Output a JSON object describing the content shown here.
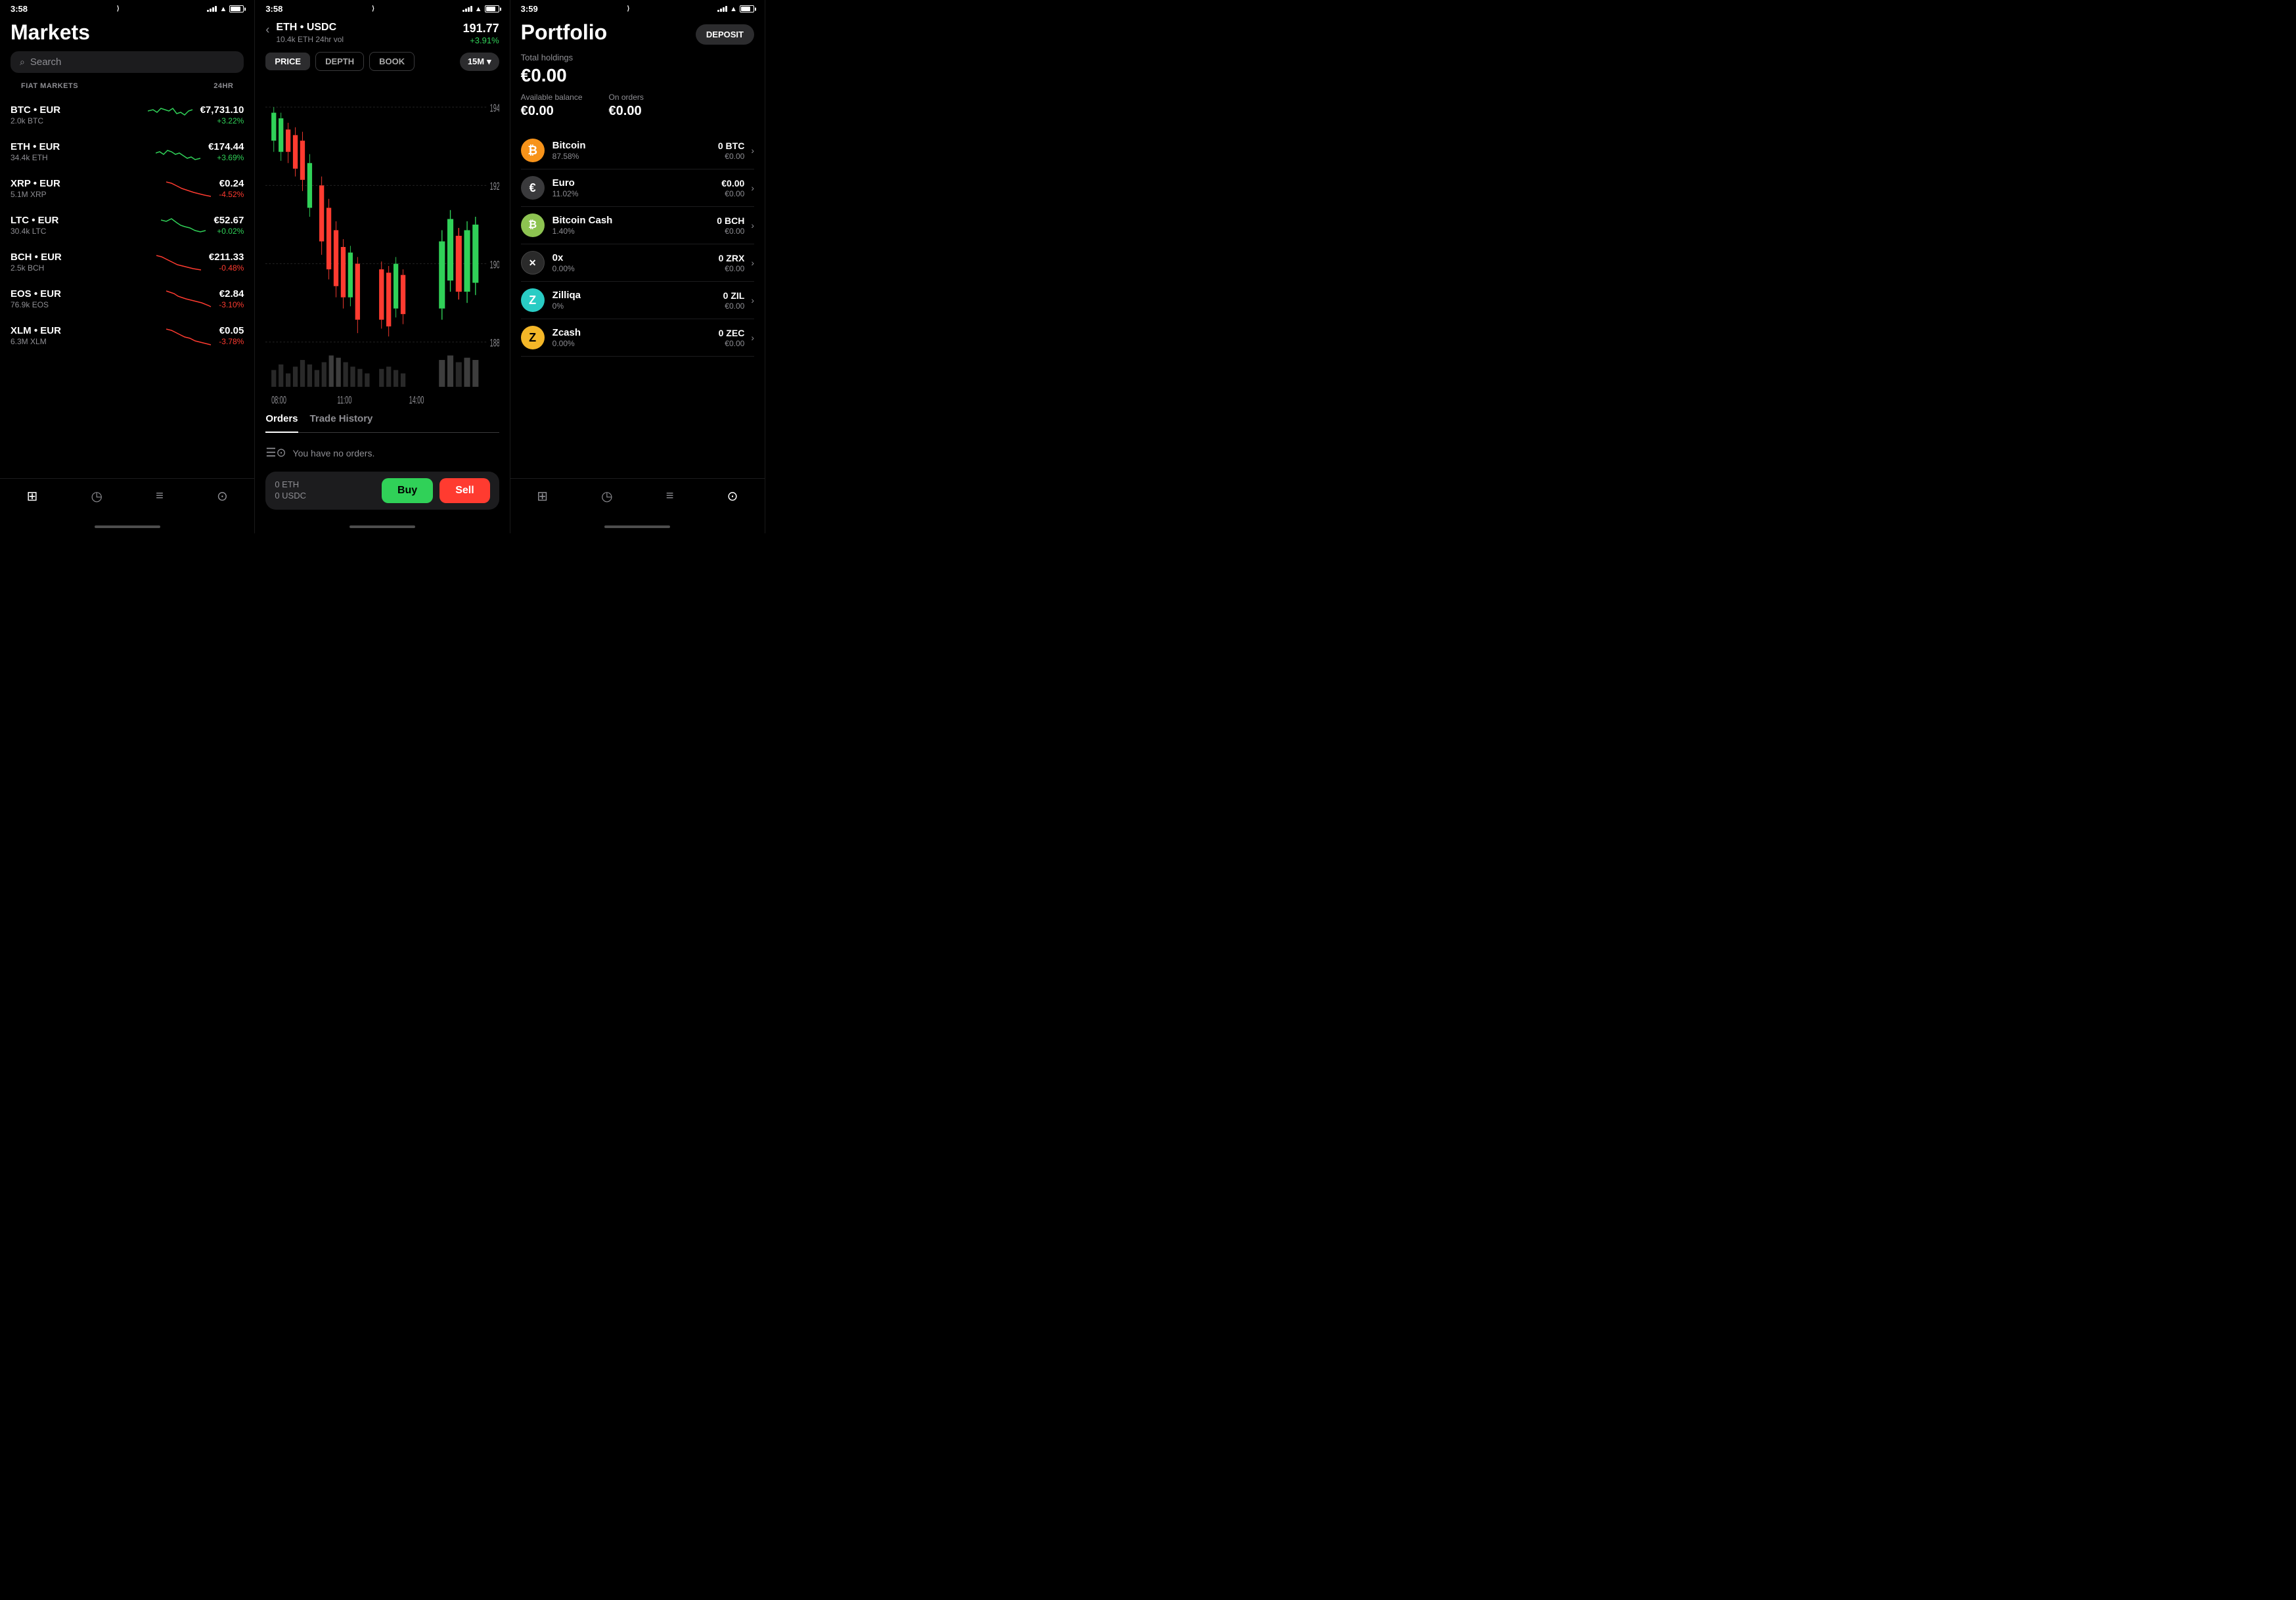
{
  "screens": {
    "markets": {
      "time": "3:58",
      "title": "Markets",
      "search_placeholder": "Search",
      "section_label": "FIAT MARKETS",
      "section_24hr": "24HR",
      "items": [
        {
          "pair": "BTC • EUR",
          "base": "BTC",
          "quote": "EUR",
          "volume": "2.0k BTC",
          "price": "€7,731.10",
          "change": "+3.22%",
          "positive": true
        },
        {
          "pair": "ETH • EUR",
          "base": "ETH",
          "quote": "EUR",
          "volume": "34.4k ETH",
          "price": "€174.44",
          "change": "+3.69%",
          "positive": true
        },
        {
          "pair": "XRP • EUR",
          "base": "XRP",
          "quote": "EUR",
          "volume": "5.1M XRP",
          "price": "€0.24",
          "change": "-4.52%",
          "positive": false
        },
        {
          "pair": "LTC • EUR",
          "base": "LTC",
          "quote": "EUR",
          "volume": "30.4k LTC",
          "price": "€52.67",
          "change": "+0.02%",
          "positive": true
        },
        {
          "pair": "BCH • EUR",
          "base": "BCH",
          "quote": "EUR",
          "volume": "2.5k BCH",
          "price": "€211.33",
          "change": "-0.48%",
          "positive": false
        },
        {
          "pair": "EOS • EUR",
          "base": "EOS",
          "quote": "EUR",
          "volume": "76.9k EOS",
          "price": "€2.84",
          "change": "-3.10%",
          "positive": false
        },
        {
          "pair": "XLM • EUR",
          "base": "XLM",
          "quote": "EUR",
          "volume": "6.3M XLM",
          "price": "€0.05",
          "change": "-3.78%",
          "positive": false
        }
      ],
      "nav": [
        "chart-bar",
        "pie-chart",
        "list",
        "person"
      ]
    },
    "chart": {
      "time": "3:58",
      "back_label": "‹",
      "pair": "ETH • USDC",
      "volume": "10.4k ETH 24hr vol",
      "price": "191.77",
      "change": "+3.91%",
      "tabs": [
        "PRICE",
        "DEPTH",
        "BOOK"
      ],
      "active_tab": "PRICE",
      "timeframe": "15M",
      "price_levels": [
        "194",
        "192",
        "190",
        "188"
      ],
      "time_labels": [
        "08:00",
        "11:00",
        "14:00"
      ],
      "orders_tabs": [
        "Orders",
        "Trade History"
      ],
      "active_orders_tab": "Orders",
      "no_orders_text": "You have no orders.",
      "trade_eth": "0 ETH",
      "trade_usdc": "0 USDC",
      "buy_label": "Buy",
      "sell_label": "Sell"
    },
    "portfolio": {
      "time": "3:59",
      "title": "Portfolio",
      "deposit_label": "DEPOSIT",
      "total_holdings_label": "Total holdings",
      "total_holdings": "€0.00",
      "available_balance_label": "Available balance",
      "available_balance": "€0.00",
      "on_orders_label": "On orders",
      "on_orders": "€0.00",
      "assets": [
        {
          "name": "Bitcoin",
          "symbol": "BTC",
          "pct": "87.58%",
          "amount": "0 BTC",
          "eur": "€0.00",
          "color": "#f7931a",
          "icon": "₿",
          "icon_color": "#fff"
        },
        {
          "name": "Euro",
          "symbol": "EUR",
          "pct": "11.02%",
          "amount": "€0.00",
          "eur": "€0.00",
          "color": "#555",
          "icon": "€",
          "icon_color": "#fff"
        },
        {
          "name": "Bitcoin Cash",
          "symbol": "BCH",
          "pct": "1.40%",
          "amount": "0 BCH",
          "eur": "€0.00",
          "color": "#8dc351",
          "icon": "₿",
          "icon_color": "#fff"
        },
        {
          "name": "0x",
          "symbol": "ZRX",
          "pct": "0.00%",
          "amount": "0 ZRX",
          "eur": "€0.00",
          "color": "#333",
          "icon": "✕",
          "icon_color": "#fff"
        },
        {
          "name": "Zilliqa",
          "symbol": "ZIL",
          "pct": "0%",
          "amount": "0 ZIL",
          "eur": "€0.00",
          "color": "#29ccc4",
          "icon": "Z",
          "icon_color": "#fff"
        },
        {
          "name": "Zcash",
          "symbol": "ZEC",
          "pct": "0.00%",
          "amount": "0 ZEC",
          "eur": "€0.00",
          "color": "#f4b728",
          "icon": "Z",
          "icon_color": "#000"
        }
      ],
      "nav": [
        "chart-bar",
        "pie-chart",
        "list",
        "person"
      ]
    }
  }
}
